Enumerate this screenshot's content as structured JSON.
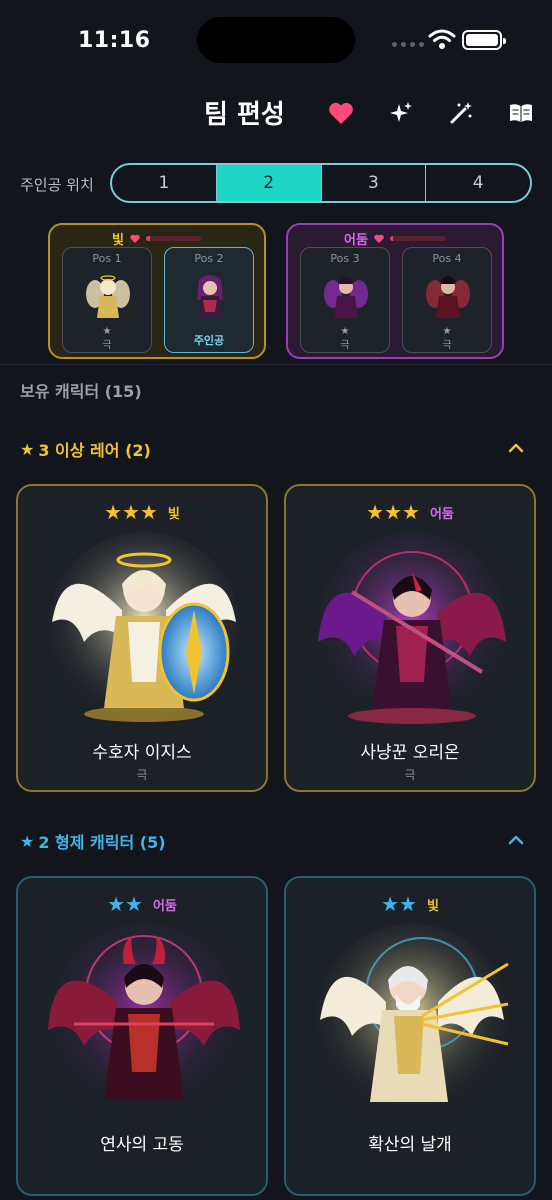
{
  "status": {
    "time": "11:16"
  },
  "header": {
    "title": "팀 편성",
    "icons": [
      "heart-icon",
      "sparkles-icon",
      "magic-wand-icon",
      "book-icon"
    ]
  },
  "position_selector": {
    "label": "주인공 위치",
    "options": [
      "1",
      "2",
      "3",
      "4"
    ],
    "selected": "2"
  },
  "teams": [
    {
      "attribute": "빛",
      "hp_fraction": 0.08,
      "slots": [
        {
          "title": "Pos 1",
          "star": "★",
          "rank": "극"
        },
        {
          "title": "Pos 2",
          "hero_label": "주인공"
        }
      ]
    },
    {
      "attribute": "어둠",
      "hp_fraction": 0.05,
      "slots": [
        {
          "title": "Pos 3",
          "star": "★",
          "rank": "극"
        },
        {
          "title": "Pos 4",
          "star": "★",
          "rank": "극"
        }
      ]
    }
  ],
  "owned": {
    "label": "보유 캐릭터 (15)"
  },
  "sections": [
    {
      "star_icon": "★",
      "title": "3 이상 레어 (2)",
      "cards": [
        {
          "stars": "★★★",
          "attribute": "빛",
          "name": "수호자 이지스",
          "rank": "극"
        },
        {
          "stars": "★★★",
          "attribute": "어둠",
          "name": "사냥꾼 오리온",
          "rank": "극"
        }
      ]
    },
    {
      "star_icon": "★",
      "title": "2 형제 캐릭터 (5)",
      "cards": [
        {
          "stars": "★★",
          "attribute": "어둠",
          "name": "연사의 고동"
        },
        {
          "stars": "★★",
          "attribute": "빛",
          "name": "확산의 날개"
        }
      ]
    }
  ],
  "colors": {
    "accent": "#1fd6c4",
    "light_attr": "#f2c230",
    "dark_attr": "#d86cf0",
    "star_gold": "#f2c230",
    "star_blue": "#41b4ec",
    "heart": "#ff4a7a"
  }
}
